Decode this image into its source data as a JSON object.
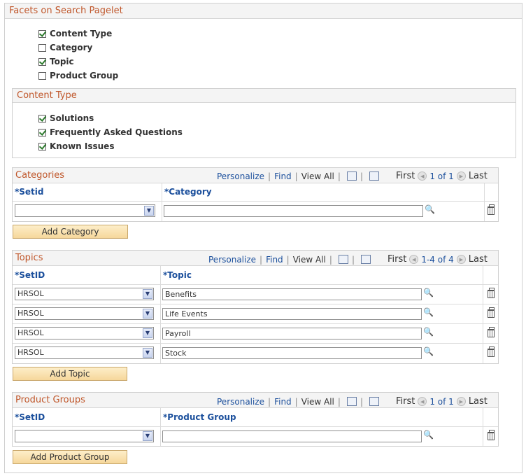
{
  "facets": {
    "title": "Facets on Search Pagelet",
    "items": [
      {
        "label": "Content Type",
        "checked": true
      },
      {
        "label": "Category",
        "checked": false
      },
      {
        "label": "Topic",
        "checked": true
      },
      {
        "label": "Product Group",
        "checked": false
      }
    ]
  },
  "content_type": {
    "title": "Content Type",
    "items": [
      {
        "label": "Solutions",
        "checked": true
      },
      {
        "label": "Frequently Asked Questions",
        "checked": true
      },
      {
        "label": "Known Issues",
        "checked": true
      }
    ]
  },
  "nav": {
    "personalize": "Personalize",
    "find": "Find",
    "view_all": "View All",
    "first": "First",
    "last": "Last"
  },
  "categories": {
    "title": "Categories",
    "count": "1 of 1",
    "col1": "*Setid",
    "col2": "*Category",
    "rows": [
      {
        "setid": "",
        "value": ""
      }
    ],
    "add_label": "Add Category"
  },
  "topics": {
    "title": "Topics",
    "count": "1-4 of 4",
    "col1": "*SetID",
    "col2": "*Topic",
    "rows": [
      {
        "setid": "HRSOL",
        "value": "Benefits"
      },
      {
        "setid": "HRSOL",
        "value": "Life Events"
      },
      {
        "setid": "HRSOL",
        "value": "Payroll"
      },
      {
        "setid": "HRSOL",
        "value": "Stock"
      }
    ],
    "add_label": "Add Topic"
  },
  "product_groups": {
    "title": "Product Groups",
    "count": "1 of 1",
    "col1": "*SetID",
    "col2": "*Product Group",
    "rows": [
      {
        "setid": "",
        "value": ""
      }
    ],
    "add_label": "Add Product Group"
  }
}
